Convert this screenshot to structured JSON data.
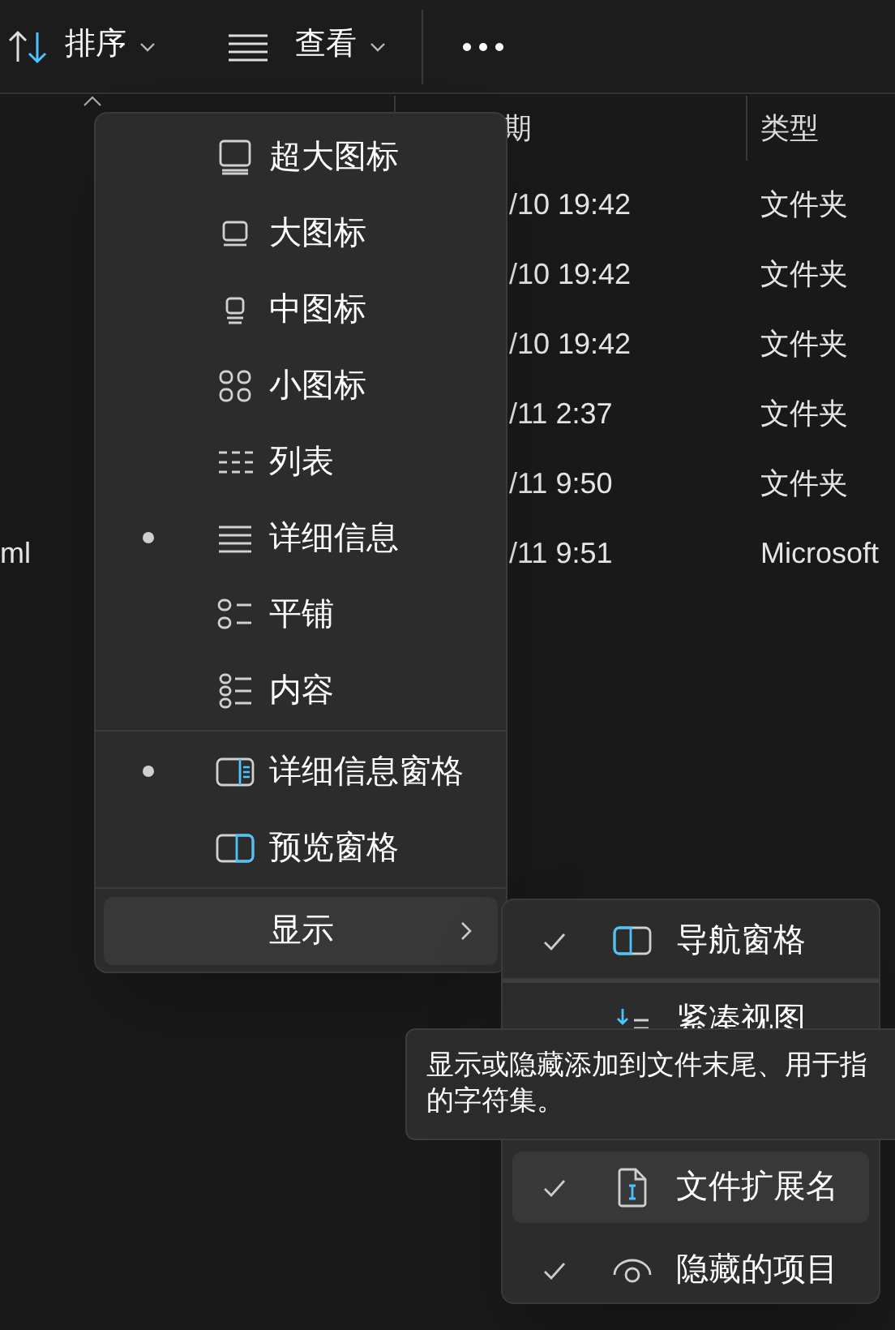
{
  "toolbar": {
    "sort": "排序",
    "view": "查看"
  },
  "columns": {
    "column_2": "期",
    "type": "类型"
  },
  "rows": [
    {
      "date": "/10 19:42",
      "type": "文件夹"
    },
    {
      "date": "/10 19:42",
      "type": "文件夹"
    },
    {
      "date": "/10 19:42",
      "type": "文件夹"
    },
    {
      "date": "/11 2:37",
      "type": "文件夹"
    },
    {
      "date": "/11 9:50",
      "type": "文件夹"
    },
    {
      "name": "ml",
      "date": "/11 9:51",
      "type": "Microsoft"
    }
  ],
  "view_menu": {
    "layouts": [
      {
        "label": "超大图标",
        "selected": false
      },
      {
        "label": "大图标",
        "selected": false
      },
      {
        "label": "中图标",
        "selected": false
      },
      {
        "label": "小图标",
        "selected": false
      },
      {
        "label": "列表",
        "selected": false
      },
      {
        "label": "详细信息",
        "selected": true
      },
      {
        "label": "平铺",
        "selected": false
      },
      {
        "label": "内容",
        "selected": false
      }
    ],
    "panes": [
      {
        "label": "详细信息窗格",
        "selected": true
      },
      {
        "label": "预览窗格",
        "selected": false
      }
    ],
    "show": {
      "label": "显示",
      "highlighted": true
    }
  },
  "show_menu": [
    {
      "label": "导航窗格",
      "checked": true,
      "highlighted": false
    },
    {
      "label": "紧凑视图",
      "checked": false,
      "highlighted": false
    },
    {
      "label": "文件扩展名",
      "checked": true,
      "highlighted": true
    },
    {
      "label": "隐藏的项目",
      "checked": true,
      "highlighted": false
    }
  ],
  "tooltip": "显示或隐藏添加到文件末尾、用于指的字符集。"
}
